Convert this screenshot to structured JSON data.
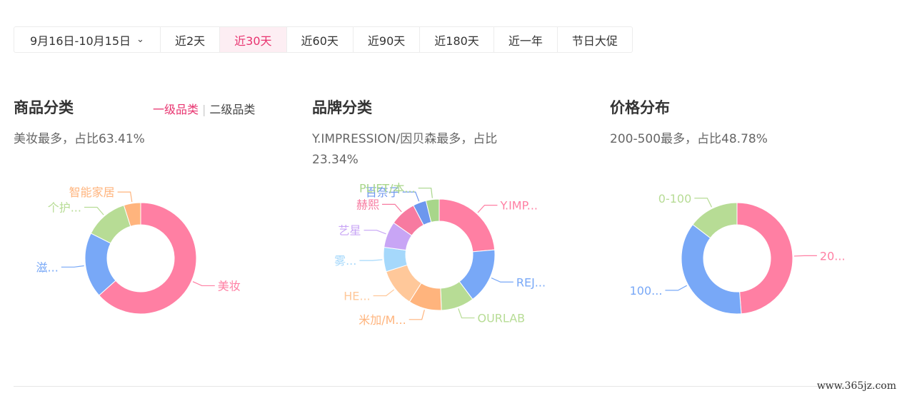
{
  "date_range": {
    "current": "9月16日-10月15日",
    "options": [
      "近2天",
      "近30天",
      "近60天",
      "近90天",
      "近180天",
      "近一年",
      "节日大促"
    ],
    "active_index": 1
  },
  "sections": {
    "category": {
      "title": "商品分类",
      "tabs": [
        "一级品类",
        "二级品类"
      ],
      "active_tab": 0,
      "subtitle": "美妆最多，占比63.41%"
    },
    "brand": {
      "title": "品牌分类",
      "subtitle": "Y.IMPRESSION/因贝森最多，占比23.34%"
    },
    "price": {
      "title": "价格分布",
      "subtitle": "200-500最多，占比48.78%"
    }
  },
  "site": "www.365jz.com",
  "chart_data": [
    {
      "type": "pie",
      "donut": true,
      "slices": [
        {
          "label": "美妆",
          "value": 63.41,
          "color": "#ff7fa3"
        },
        {
          "label": "滋...",
          "value": 19.0,
          "color": "#78a8f7"
        },
        {
          "label": "个护...",
          "value": 12.7,
          "color": "#b7dc95"
        },
        {
          "label": "智能家居",
          "value": 4.89,
          "color": "#ffb47d"
        }
      ]
    },
    {
      "type": "pie",
      "donut": true,
      "slices": [
        {
          "label": "Y.IMP...",
          "value": 23.34,
          "color": "#ff7fa3"
        },
        {
          "label": "REJ...",
          "value": 16.0,
          "color": "#78a8f7"
        },
        {
          "label": "OURLAB",
          "value": 9.5,
          "color": "#b7dc95"
        },
        {
          "label": "米加/M...",
          "value": 9.5,
          "color": "#ffb47d"
        },
        {
          "label": "HE...",
          "value": 11.0,
          "color": "#ffc89a"
        },
        {
          "label": "雾...",
          "value": 7.0,
          "color": "#a5d8fb"
        },
        {
          "label": "艺星",
          "value": 7.5,
          "color": "#c8a5f5"
        },
        {
          "label": "赫熙",
          "value": 7.5,
          "color": "#f77aa0"
        },
        {
          "label": "百奈子",
          "value": 3.8,
          "color": "#6d97ee"
        },
        {
          "label": "PLIFT/本...",
          "value": 3.8,
          "color": "#a8d68a"
        }
      ]
    },
    {
      "type": "pie",
      "donut": true,
      "slices": [
        {
          "label": "20...",
          "value": 48.78,
          "color": "#ff7fa3"
        },
        {
          "label": "100...",
          "value": 36.59,
          "color": "#78a8f7"
        },
        {
          "label": "0-100",
          "value": 14.63,
          "color": "#b7dc95"
        }
      ]
    }
  ]
}
